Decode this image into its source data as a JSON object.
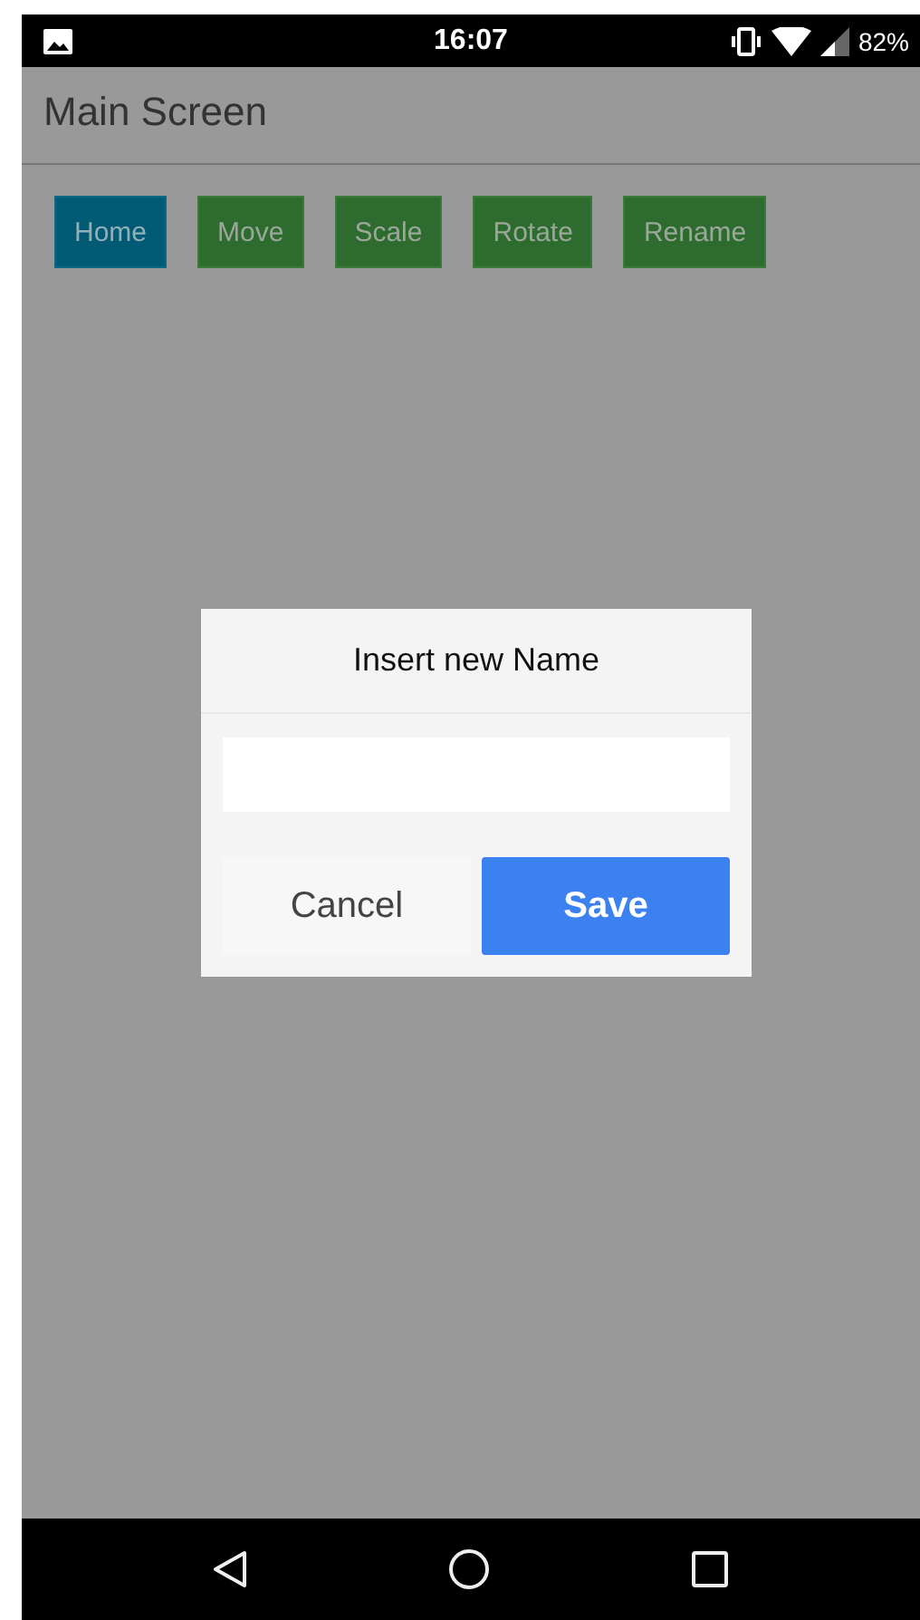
{
  "status_bar": {
    "time": "16:07",
    "battery": "82%"
  },
  "app_bar": {
    "title": "Main Screen"
  },
  "toolbar": [
    {
      "label": "Home",
      "selected": true
    },
    {
      "label": "Move",
      "selected": false
    },
    {
      "label": "Scale",
      "selected": false
    },
    {
      "label": "Rotate",
      "selected": false
    },
    {
      "label": "Rename",
      "selected": false
    }
  ],
  "dialog": {
    "title": "Insert new Name",
    "buttons": [
      {
        "label": "Cancel",
        "kind": "secondary"
      },
      {
        "label": "Save",
        "kind": "primary"
      }
    ]
  }
}
